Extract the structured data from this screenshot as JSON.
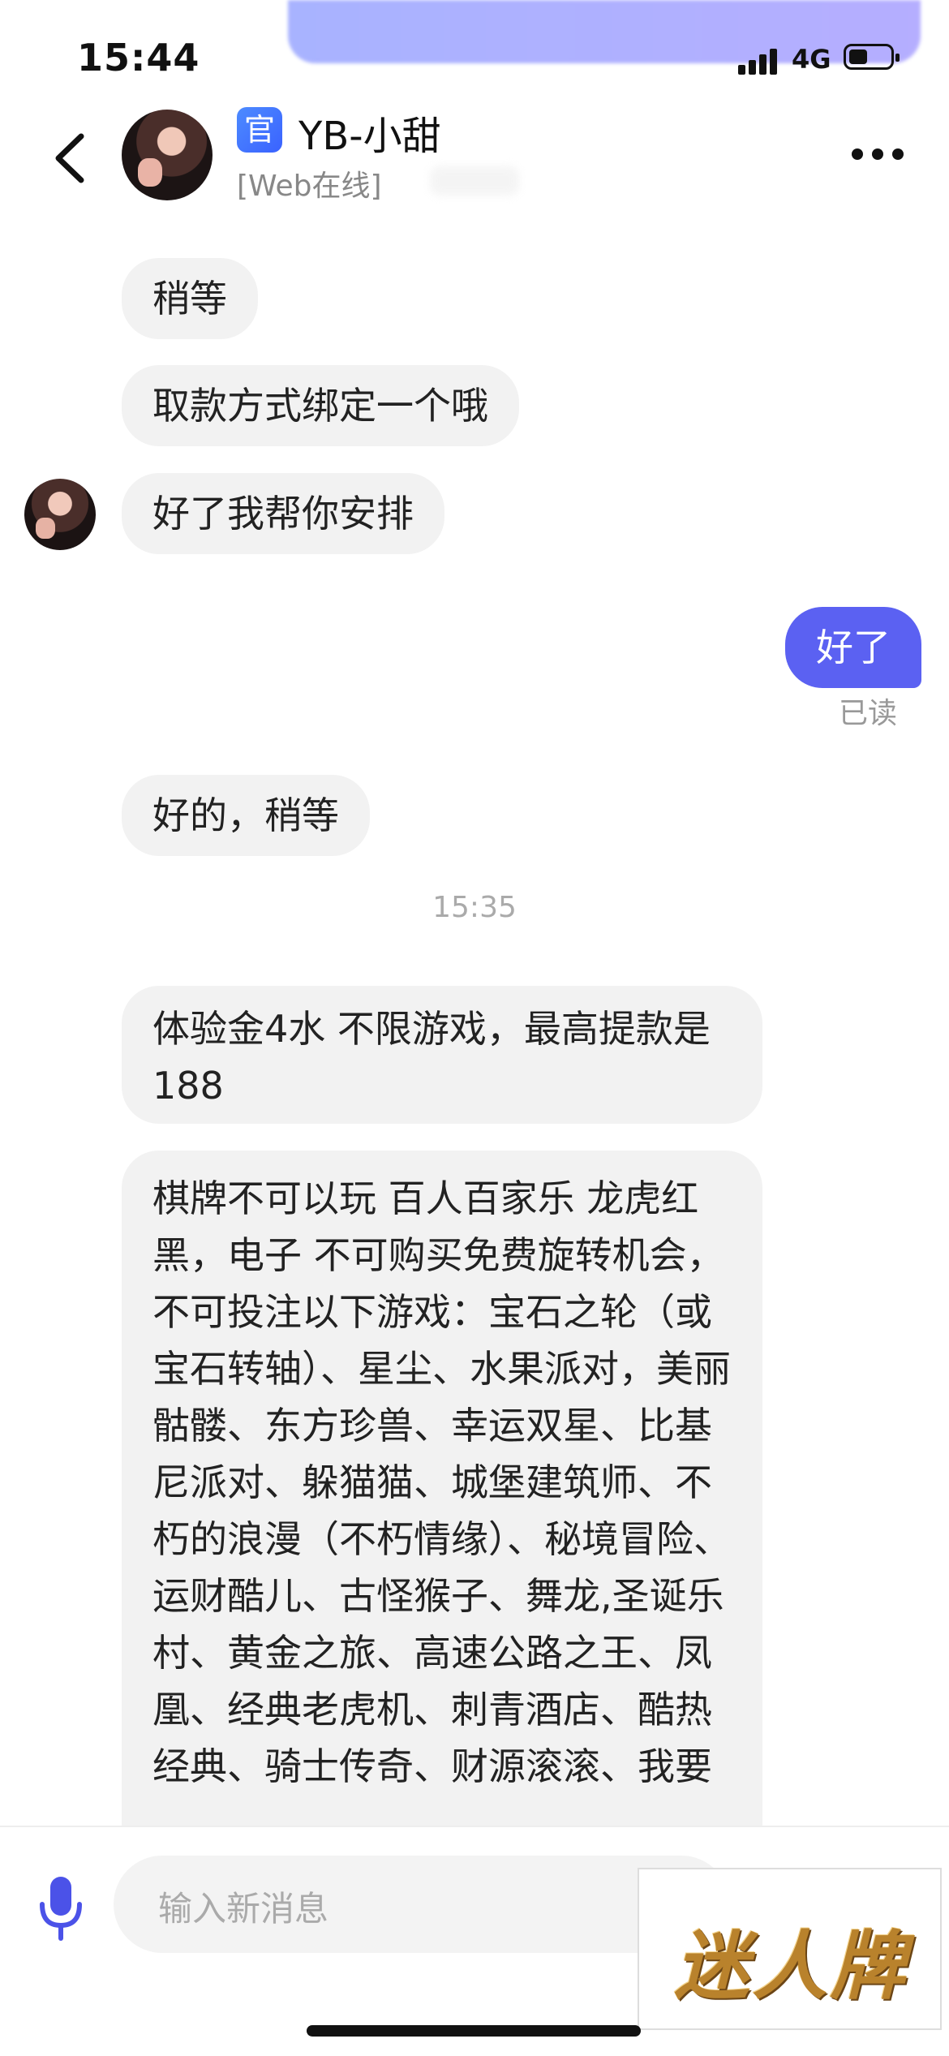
{
  "status_bar": {
    "time": "15:44",
    "network": "4G"
  },
  "header": {
    "official_badge": "官",
    "contact_name": "YB-小甜",
    "presence": "[Web在线]"
  },
  "messages": {
    "m1": "稍等",
    "m2": "取款方式绑定一个哦",
    "m3": "好了我帮你安排",
    "m4_out": "好了",
    "m4_status": "已读",
    "m5": "好的，稍等",
    "timestamp": "15:35",
    "m6": "体验金4水 不限游戏，最高提款是188",
    "m7": "棋牌不可以玩 百人百家乐 龙虎红黑，电子 不可购买免费旋转机会，不可投注以下游戏：宝石之轮（或宝石转轴）、星尘、水果派对，美丽骷髅、东方珍兽、幸运双星、比基尼派对、躲猫猫、城堡建筑师、不朽的浪漫（不朽情缘）、秘境冒险、运财酷儿、古怪猴子、舞龙,圣诞乐村、黄金之旅、高速公路之王、凤凰、经典老虎机、刺青酒店、酷热经典、骑士传奇、财源滚滚、我要"
  },
  "composer": {
    "placeholder": "输入新消息"
  },
  "watermark": {
    "text": "迷人牌"
  },
  "colors": {
    "outgoing_bubble": "#5b61f2",
    "incoming_bubble": "#f2f2f2",
    "badge": "#3a62ff"
  }
}
